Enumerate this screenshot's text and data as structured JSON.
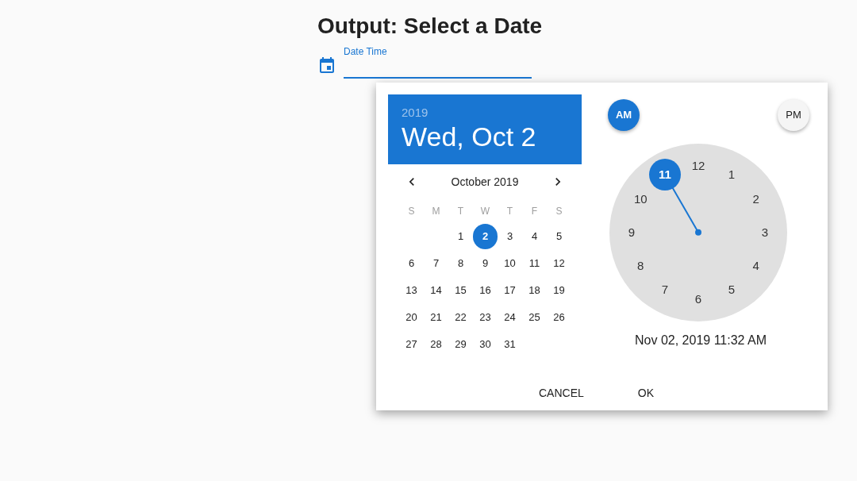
{
  "heading": "Output: Select a Date",
  "field": {
    "label": "Date Time"
  },
  "picker": {
    "year": "2019",
    "date": "Wed, Oct 2",
    "month": "October 2019",
    "weekdays": [
      "S",
      "M",
      "T",
      "W",
      "T",
      "F",
      "S"
    ],
    "weeks": [
      [
        {
          "kind": "blank"
        },
        {
          "kind": "blank"
        },
        {
          "kind": "day",
          "day": "1",
          "selected": false
        },
        {
          "kind": "day",
          "day": "2",
          "selected": true
        },
        {
          "kind": "day",
          "day": "3",
          "selected": false
        },
        {
          "kind": "day",
          "day": "4",
          "selected": false
        },
        {
          "kind": "day",
          "day": "5",
          "selected": false
        }
      ],
      [
        {
          "kind": "day",
          "day": "6",
          "selected": false
        },
        {
          "kind": "day",
          "day": "7",
          "selected": false
        },
        {
          "kind": "day",
          "day": "8",
          "selected": false
        },
        {
          "kind": "day",
          "day": "9",
          "selected": false
        },
        {
          "kind": "day",
          "day": "10",
          "selected": false
        },
        {
          "kind": "day",
          "day": "11",
          "selected": false
        },
        {
          "kind": "day",
          "day": "12",
          "selected": false
        }
      ],
      [
        {
          "kind": "day",
          "day": "13",
          "selected": false
        },
        {
          "kind": "day",
          "day": "14",
          "selected": false
        },
        {
          "kind": "day",
          "day": "15",
          "selected": false
        },
        {
          "kind": "day",
          "day": "16",
          "selected": false
        },
        {
          "kind": "day",
          "day": "17",
          "selected": false
        },
        {
          "kind": "day",
          "day": "18",
          "selected": false
        },
        {
          "kind": "day",
          "day": "19",
          "selected": false
        }
      ],
      [
        {
          "kind": "day",
          "day": "20",
          "selected": false
        },
        {
          "kind": "day",
          "day": "21",
          "selected": false
        },
        {
          "kind": "day",
          "day": "22",
          "selected": false
        },
        {
          "kind": "day",
          "day": "23",
          "selected": false
        },
        {
          "kind": "day",
          "day": "24",
          "selected": false
        },
        {
          "kind": "day",
          "day": "25",
          "selected": false
        },
        {
          "kind": "day",
          "day": "26",
          "selected": false
        }
      ],
      [
        {
          "kind": "day",
          "day": "27",
          "selected": false
        },
        {
          "kind": "day",
          "day": "28",
          "selected": false
        },
        {
          "kind": "day",
          "day": "29",
          "selected": false
        },
        {
          "kind": "day",
          "day": "30",
          "selected": false
        },
        {
          "kind": "day",
          "day": "31",
          "selected": false
        },
        {
          "kind": "blank"
        },
        {
          "kind": "blank"
        }
      ]
    ],
    "meridiem": [
      {
        "label": "AM",
        "selected": true
      },
      {
        "label": "PM",
        "selected": false
      }
    ],
    "hours": [
      {
        "label": "12",
        "selected": false
      },
      {
        "label": "1",
        "selected": false
      },
      {
        "label": "2",
        "selected": false
      },
      {
        "label": "3",
        "selected": false
      },
      {
        "label": "4",
        "selected": false
      },
      {
        "label": "5",
        "selected": false
      },
      {
        "label": "6",
        "selected": false
      },
      {
        "label": "7",
        "selected": false
      },
      {
        "label": "8",
        "selected": false
      },
      {
        "label": "9",
        "selected": false
      },
      {
        "label": "10",
        "selected": false
      },
      {
        "label": "11",
        "selected": true
      }
    ],
    "datetime": "Nov 02, 2019 11:32 AM",
    "buttons": [
      "CANCEL",
      "OK"
    ]
  }
}
